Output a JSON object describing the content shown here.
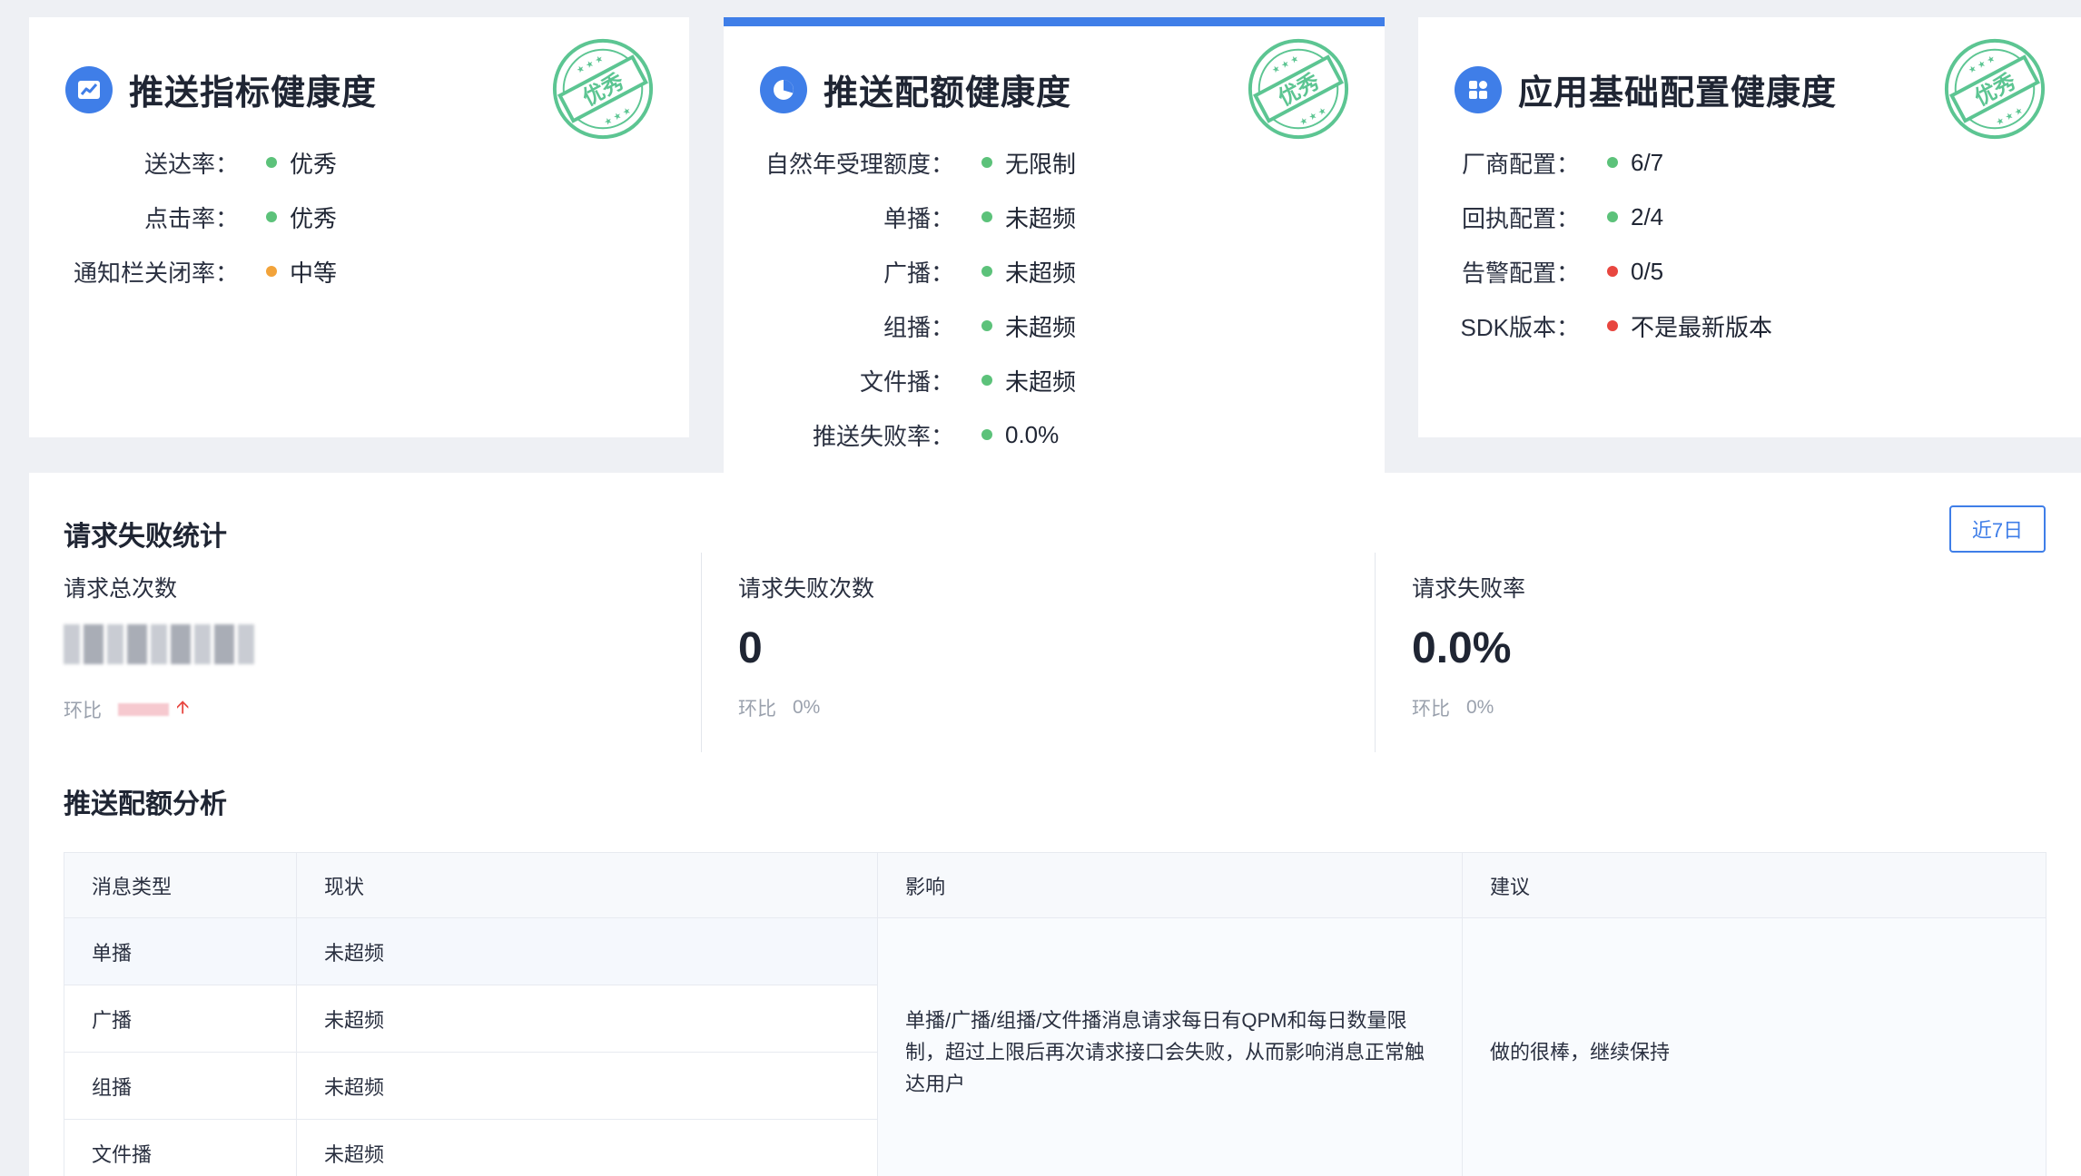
{
  "health_cards": {
    "metrics": {
      "title": "推送指标健康度",
      "stamp": "优秀",
      "icon": "trend-chart-icon",
      "rows": [
        {
          "label": "送达率：",
          "value": "优秀",
          "status": "green"
        },
        {
          "label": "点击率：",
          "value": "优秀",
          "status": "green"
        },
        {
          "label": "通知栏关闭率：",
          "value": "中等",
          "status": "orange"
        }
      ]
    },
    "quota": {
      "title": "推送配额健康度",
      "stamp": "优秀",
      "icon": "pie-chart-icon",
      "rows": [
        {
          "label": "自然年受理额度：",
          "value": "无限制",
          "status": "green"
        },
        {
          "label": "单播：",
          "value": "未超频",
          "status": "green"
        },
        {
          "label": "广播：",
          "value": "未超频",
          "status": "green"
        },
        {
          "label": "组播：",
          "value": "未超频",
          "status": "green"
        },
        {
          "label": "文件播：",
          "value": "未超频",
          "status": "green"
        },
        {
          "label": "推送失败率：",
          "value": "0.0%",
          "status": "green"
        }
      ]
    },
    "config": {
      "title": "应用基础配置健康度",
      "stamp": "优秀",
      "icon": "apps-grid-icon",
      "rows": [
        {
          "label": "厂商配置：",
          "value": "6/7",
          "status": "green"
        },
        {
          "label": "回执配置：",
          "value": "2/4",
          "status": "green"
        },
        {
          "label": "告警配置：",
          "value": "0/5",
          "status": "red"
        },
        {
          "label": "SDK版本：",
          "value": "不是最新版本",
          "status": "red"
        }
      ]
    }
  },
  "colors": {
    "accent": "#3f7ee8",
    "green": "#5cc27a",
    "orange": "#f2a33a",
    "red": "#e8463f",
    "stamp": "#5cc592"
  },
  "request_stats": {
    "title": "请求失败统计",
    "range_button": "近7日",
    "total": {
      "label": "请求总次数",
      "sub_label": "环比"
    },
    "fails": {
      "label": "请求失败次数",
      "value": "0",
      "sub_label": "环比",
      "change": "0%"
    },
    "rate": {
      "label": "请求失败率",
      "value": "0.0%",
      "sub_label": "环比",
      "change": "0%"
    }
  },
  "quota_analysis": {
    "title": "推送配额分析",
    "headers": [
      "消息类型",
      "现状",
      "影响",
      "建议"
    ],
    "rows": [
      {
        "type": "单播",
        "status": "未超频"
      },
      {
        "type": "广播",
        "status": "未超频"
      },
      {
        "type": "组播",
        "status": "未超频"
      },
      {
        "type": "文件播",
        "status": "未超频"
      }
    ],
    "impact": "单播/广播/组播/文件播消息请求每日有QPM和每日数量限制，超过上限后再次请求接口会失败，从而影响消息正常触达用户",
    "advice": "做的很棒，继续保持"
  }
}
